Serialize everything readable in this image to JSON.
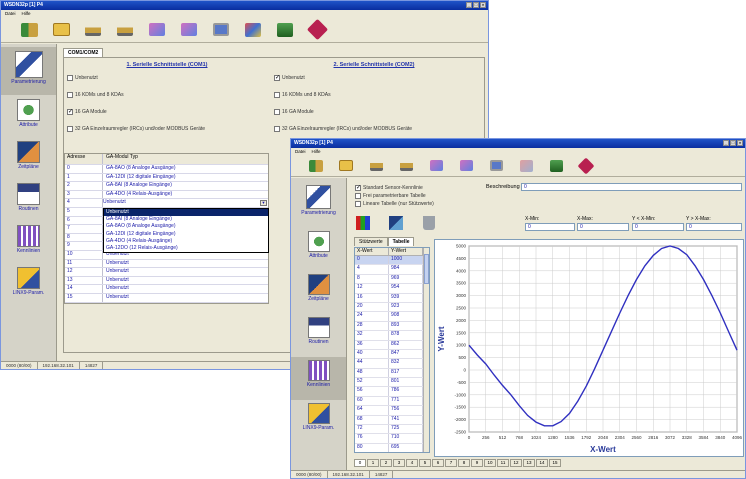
{
  "back": {
    "title": "WSDN32p [1] P4",
    "menu": [
      "Datei",
      "Hilfe"
    ],
    "tab": "COM1/COM2",
    "sidebar": [
      {
        "label": "Parametrierung",
        "icon": "parameter-icon"
      },
      {
        "label": "Attribute",
        "icon": "attribute-icon"
      },
      {
        "label": "Zeitpläne",
        "icon": "schedule-icon"
      },
      {
        "label": "Routinen",
        "icon": "routine-icon"
      },
      {
        "label": "Kennlinien",
        "icon": "curve-icon"
      },
      {
        "label": "LINX9-Param.",
        "icon": "linx-param-icon"
      }
    ],
    "section1": {
      "title": "1. Serielle Schnittstelle (COM1)",
      "options": [
        {
          "label": "Unbenutzt",
          "checked": false
        },
        {
          "label": "16 KDMs und 8 KDAs",
          "checked": false
        },
        {
          "label": "16 GA Module",
          "checked": true
        },
        {
          "label": "32 GA Einzelraumregler (IRCs) und/oder MODBUS Geräte",
          "checked": false
        }
      ]
    },
    "section2": {
      "title": "2. Serielle Schnittstelle (COM2)",
      "options": [
        {
          "label": "Unbenutzt",
          "checked": true
        },
        {
          "label": "16 KDMs und 8 KDAs",
          "checked": false
        },
        {
          "label": "16 GA Module",
          "checked": false
        },
        {
          "label": "32 GA Einzelraumregler (IRCs) und/oder MODBUS Geräte",
          "checked": false
        }
      ]
    },
    "table": {
      "headers": [
        "Adresse",
        "GA-Modul Typ"
      ],
      "rows": [
        [
          "0",
          "GA-8AO (8 Analoge Ausgänge)"
        ],
        [
          "1",
          "GA-12DI (12 digitale Eingänge)"
        ],
        [
          "2",
          "GA-8AI (8 Analoge Eingänge)"
        ],
        [
          "3",
          "GA-4DO (4 Relais-Ausgänge)"
        ],
        [
          "4",
          "Unbenutzt"
        ]
      ],
      "dropdown_options": [
        "Unbenutzt",
        "GA-8AI (8 Analoge Eingänge)",
        "GA-8AO (8 Analoge Ausgänge)",
        "GA-12DI (12 digitale Eingänge)",
        "GA-4DO (4 Relais-Ausgänge)",
        "GA-12DO (12 Relais-Ausgänge)"
      ],
      "rows_after": [
        [
          "10",
          "Unbenutzt"
        ],
        [
          "11",
          "Unbenutzt"
        ],
        [
          "12",
          "Unbenutzt"
        ],
        [
          "13",
          "Unbenutzt"
        ],
        [
          "14",
          "Unbenutzt"
        ],
        [
          "15",
          "Unbenutzt"
        ]
      ],
      "hidden_row_labels": [
        "5",
        "6",
        "7",
        "8",
        "9"
      ]
    },
    "status": [
      "0000 (80/00)",
      "192.168.32.101",
      "14827"
    ]
  },
  "front": {
    "title": "WSDN32p [1] P4",
    "menu": [
      "Datei",
      "Hilfe"
    ],
    "sidebar": [
      {
        "label": "Parametrierung",
        "icon": "parameter-icon"
      },
      {
        "label": "Attribute",
        "icon": "attribute-icon"
      },
      {
        "label": "Zeitpläne",
        "icon": "schedule-icon"
      },
      {
        "label": "Routinen",
        "icon": "routine-icon"
      },
      {
        "label": "Kennlinien",
        "icon": "curve-icon"
      },
      {
        "label": "LINX9-Param.",
        "icon": "linx-param-icon"
      }
    ],
    "options": [
      {
        "label": "Standard Sensor-Kennlinie",
        "checked": true
      },
      {
        "label": "Frei parametrierbare Tabelle",
        "checked": false
      },
      {
        "label": "Lineare Tabelle (nur Stützwerte)",
        "checked": false
      }
    ],
    "beschreibung_label": "Beschreibung",
    "beschreibung_value": "0",
    "param_headers": [
      "X-Min:",
      "X-Max:",
      "Y < X-Min:",
      "Y > X-Max:"
    ],
    "param_values": [
      "0",
      "0",
      "0",
      "0"
    ],
    "tabs": [
      "Stützwerte",
      "Tabelle"
    ],
    "table_headers": [
      "X-Wert",
      "Y-Wert"
    ],
    "table_rows": [
      [
        "0",
        "1000"
      ],
      [
        "4",
        "984"
      ],
      [
        "8",
        "969"
      ],
      [
        "12",
        "954"
      ],
      [
        "16",
        "939"
      ],
      [
        "20",
        "923"
      ],
      [
        "24",
        "908"
      ],
      [
        "28",
        "893"
      ],
      [
        "32",
        "878"
      ],
      [
        "36",
        "862"
      ],
      [
        "40",
        "847"
      ],
      [
        "44",
        "832"
      ],
      [
        "48",
        "817"
      ],
      [
        "52",
        "801"
      ],
      [
        "56",
        "786"
      ],
      [
        "60",
        "771"
      ],
      [
        "64",
        "756"
      ],
      [
        "68",
        "741"
      ],
      [
        "72",
        "725"
      ],
      [
        "76",
        "710"
      ],
      [
        "80",
        "695"
      ]
    ],
    "page_buttons": [
      "0",
      "1",
      "2",
      "3",
      "4",
      "5",
      "6",
      "7",
      "8",
      "9",
      "10",
      "11",
      "12",
      "13",
      "14",
      "15"
    ],
    "status": [
      "0000 (80/00)",
      "192.168.32.101",
      "14827"
    ]
  },
  "chart_data": {
    "type": "line",
    "xlabel": "X-Wert",
    "ylabel": "Y-Wert",
    "xlim": [
      0,
      4096
    ],
    "ylim": [
      -2500,
      5000
    ],
    "x_ticks": [
      0,
      256,
      512,
      768,
      1024,
      1280,
      1536,
      1792,
      2048,
      2304,
      2560,
      2816,
      3072,
      3328,
      3584,
      3840,
      4096
    ],
    "y_ticks": [
      5000,
      4500,
      4000,
      3500,
      3000,
      2500,
      2000,
      1500,
      1000,
      500,
      0,
      -500,
      -1000,
      -1500,
      -2000,
      -2500
    ],
    "grid": true,
    "color": "#3030c0",
    "series": [
      {
        "x": [
          0,
          128,
          256,
          384,
          512,
          640,
          768,
          896,
          1024,
          1152,
          1280,
          1408,
          1536,
          1664,
          1792,
          1920,
          2048,
          2176,
          2304,
          2432,
          2560,
          2688,
          2816,
          2944,
          3072,
          3200,
          3328,
          3456,
          3584,
          3712,
          3840,
          3968,
          4096
        ],
        "y": [
          1000,
          600,
          240,
          -200,
          -620,
          -1000,
          -1440,
          -1830,
          -2100,
          -2250,
          -2250,
          -2080,
          -1750,
          -1250,
          -650,
          50,
          800,
          1550,
          2300,
          3000,
          3650,
          4200,
          4620,
          4900,
          5000,
          4900,
          4650,
          4200,
          3650,
          3000,
          2300,
          1550,
          800
        ]
      }
    ]
  }
}
